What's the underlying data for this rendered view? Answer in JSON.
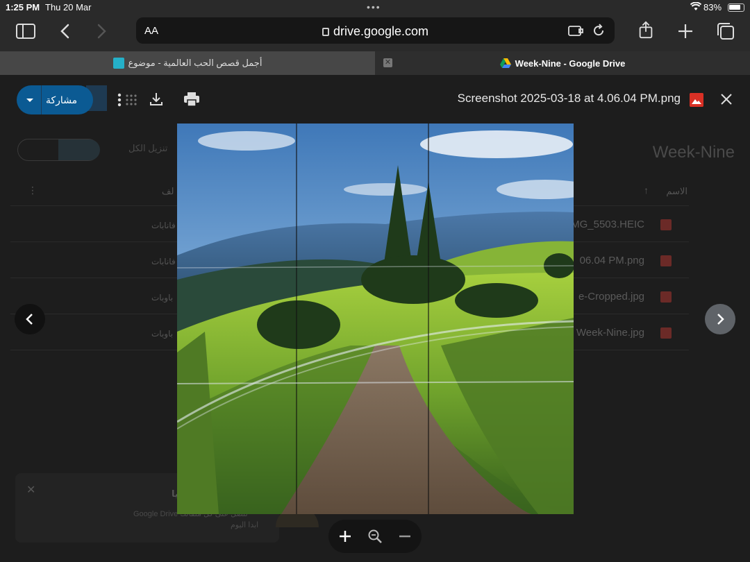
{
  "status_bar": {
    "time": "1:25 PM",
    "date": "Thu 20 Mar",
    "battery_percent": "83%"
  },
  "browser": {
    "text_size_label": "AA",
    "url": "drive.google.com",
    "tabs": [
      {
        "title": "أجمل قصص الحب العالمية - موضوع",
        "active": false
      },
      {
        "title": "Week-Nine - Google Drive",
        "active": true
      }
    ]
  },
  "drive": {
    "folder_title": "Week-Nine",
    "download_all_label": "تنزيل الكل",
    "column_name_label": "الاسم",
    "column_owner_label": "لف",
    "files": [
      {
        "name": "MG_5503.HEIC",
        "owner": "فانابات"
      },
      {
        "name": "06.04 PM.png",
        "owner": "فانابات"
      },
      {
        "name": "e-Cropped.jpg",
        "owner": "باوبات"
      },
      {
        "name": "Week-Nine.jpg",
        "owner": "باوبات"
      }
    ],
    "toast": {
      "line1": "يا",
      "line2": "Google Drive لتصل على كل ملفاتك",
      "line3": "ابدا اليوم"
    }
  },
  "preview": {
    "share_label": "مشاركة",
    "file_title": "Screenshot 2025-03-18 at 4.06.04 PM.png",
    "file_icon": "image-file-icon",
    "accent_color": "#0b5a93"
  },
  "zoom_controls": {
    "zoom_in": "+",
    "zoom_reset": "zoom-icon",
    "zoom_out": "−"
  }
}
